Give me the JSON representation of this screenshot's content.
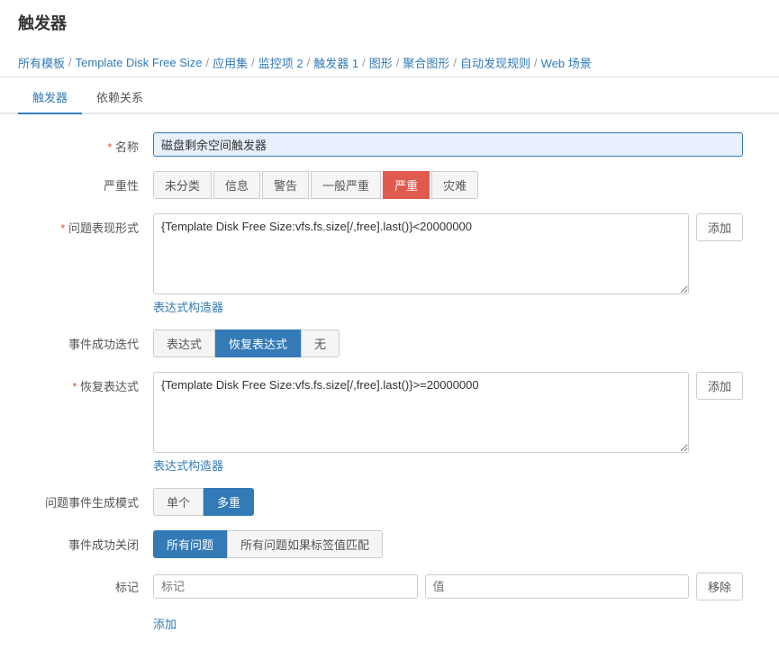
{
  "page": {
    "title": "触发器"
  },
  "breadcrumb": {
    "items": [
      {
        "label": "所有模板"
      },
      {
        "label": "Template Disk Free Size"
      },
      {
        "label": "应用集"
      },
      {
        "label": "监控项 2"
      },
      {
        "label": "触发器 1"
      },
      {
        "label": "图形"
      },
      {
        "label": "聚合图形"
      },
      {
        "label": "自动发现规则"
      },
      {
        "label": "Web 场景"
      }
    ]
  },
  "tabs": {
    "items": [
      {
        "label": "触发器",
        "active": true
      },
      {
        "label": "依赖关系",
        "active": false
      }
    ]
  },
  "form": {
    "name_label": "名称",
    "name_value": "磁盘剩余空间触发器",
    "severity_label": "严重性",
    "severity_options": [
      {
        "label": "未分类",
        "active": false
      },
      {
        "label": "信息",
        "active": false
      },
      {
        "label": "警告",
        "active": false
      },
      {
        "label": "一般严重",
        "active": false
      },
      {
        "label": "严重",
        "active": true
      },
      {
        "label": "灾难",
        "active": false
      }
    ],
    "problem_expr_label": "问题表现形式",
    "problem_expr_value": "{Template Disk Free Size:vfs.fs.size[/,free].last()}<20000000",
    "add_problem_label": "添加",
    "expr_builder_label": "表达式构造器",
    "event_success_label": "事件成功迭代",
    "event_success_options": [
      {
        "label": "表达式",
        "active": false
      },
      {
        "label": "恢复表达式",
        "active": true
      },
      {
        "label": "无",
        "active": false
      }
    ],
    "recovery_expr_label": "恢复表达式",
    "recovery_expr_value": "{Template Disk Free Size:vfs.fs.size[/,free].last()}>=20000000",
    "add_recovery_label": "添加",
    "expr_builder2_label": "表达式构造器",
    "problem_mode_label": "问题事件生成模式",
    "problem_mode_options": [
      {
        "label": "单个",
        "active": false
      },
      {
        "label": "多重",
        "active": true
      }
    ],
    "event_close_label": "事件成功关闭",
    "event_close_options": [
      {
        "label": "所有问题",
        "active": true
      },
      {
        "label": "所有问题如果标签值匹配",
        "active": false
      }
    ],
    "tag_label": "标记",
    "tag_name_placeholder": "标记",
    "tag_value_placeholder": "值",
    "remove_label": "移除",
    "add_tag_label": "添加"
  }
}
